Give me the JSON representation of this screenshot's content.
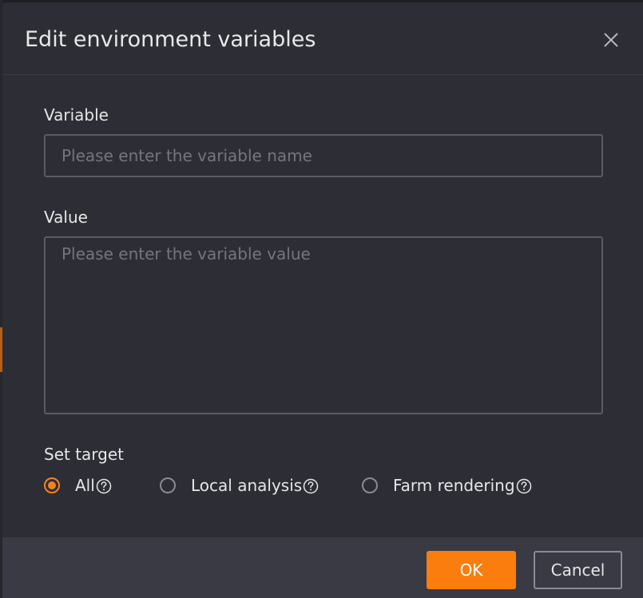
{
  "dialog": {
    "title": "Edit environment variables"
  },
  "variable_field": {
    "label": "Variable",
    "value": "",
    "placeholder": "Please enter the variable name"
  },
  "value_field": {
    "label": "Value",
    "value": "",
    "placeholder": "Please enter the variable value"
  },
  "target": {
    "label": "Set target",
    "selected": "All",
    "options": [
      {
        "label": "All",
        "checked": true,
        "icon": "help-icon"
      },
      {
        "label": "Local analysis",
        "checked": false,
        "icon": "help-icon"
      },
      {
        "label": "Farm rendering",
        "checked": false,
        "icon": "help-icon"
      }
    ]
  },
  "footer": {
    "ok_label": "OK",
    "cancel_label": "Cancel"
  },
  "colors": {
    "accent": "#fb7d0d",
    "dialog_bg": "#2d2e35",
    "footer_bg": "#393a43",
    "text": "#e6e6e8",
    "placeholder": "#75767d"
  },
  "icons": {
    "close": "close-icon",
    "help": "help-icon"
  }
}
